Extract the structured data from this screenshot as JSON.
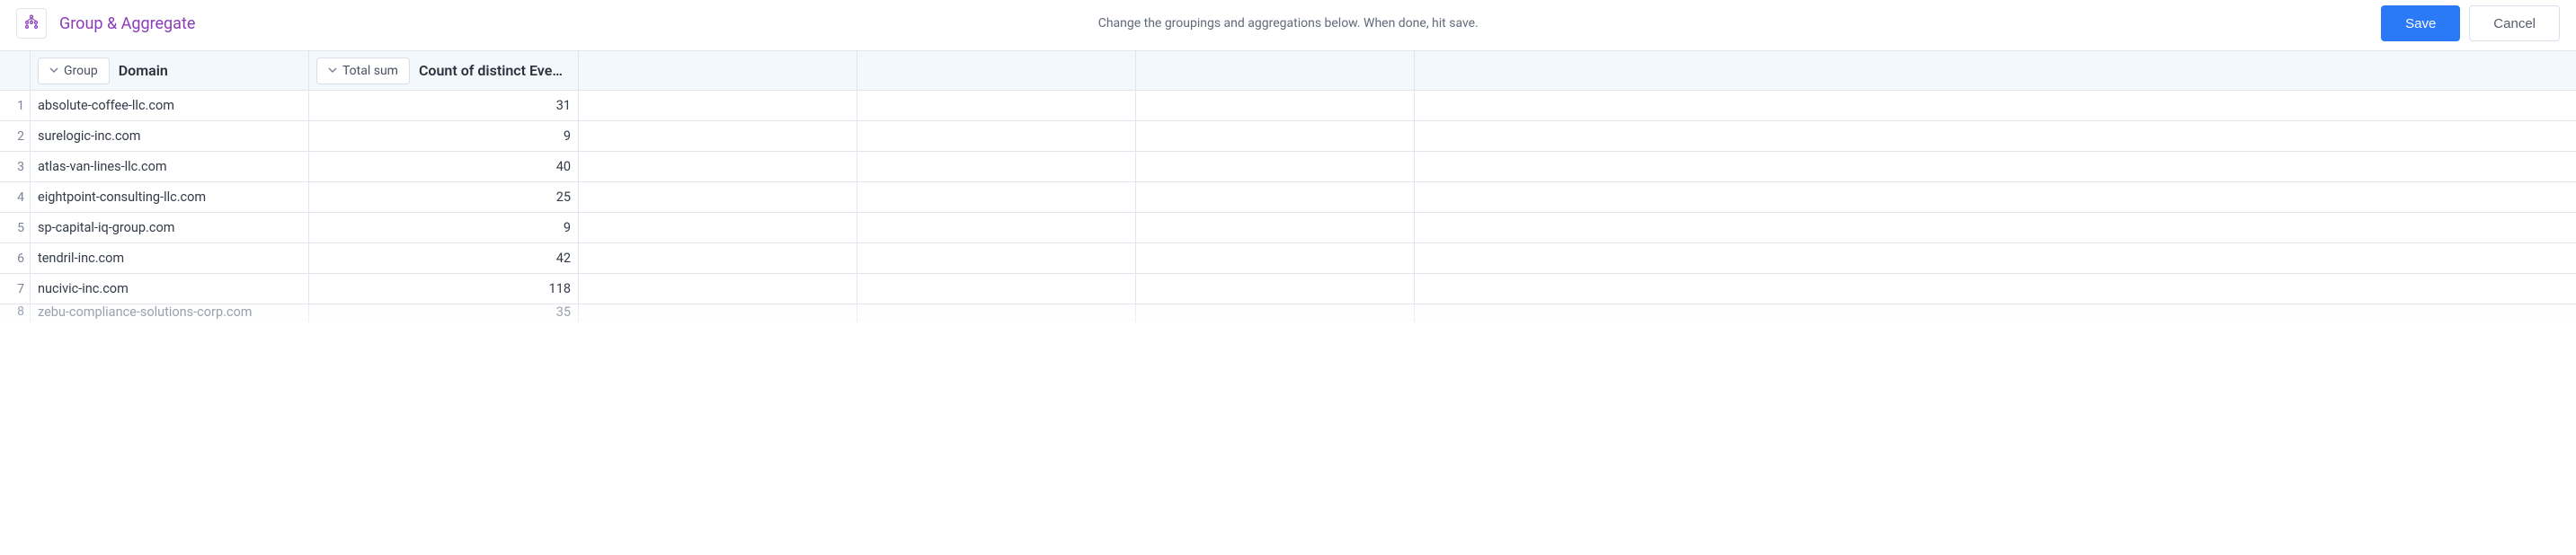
{
  "header": {
    "title": "Group & Aggregate",
    "helper": "Change the groupings and aggregations below. When done, hit save.",
    "save_label": "Save",
    "cancel_label": "Cancel"
  },
  "columns": {
    "group": {
      "pill": "Group",
      "title": "Domain"
    },
    "agg": {
      "pill": "Total sum",
      "title": "Count of distinct Eve…"
    }
  },
  "rows": [
    {
      "n": "1",
      "domain": "absolute-coffee-llc.com",
      "count": "31"
    },
    {
      "n": "2",
      "domain": "surelogic-inc.com",
      "count": "9"
    },
    {
      "n": "3",
      "domain": "atlas-van-lines-llc.com",
      "count": "40"
    },
    {
      "n": "4",
      "domain": "eightpoint-consulting-llc.com",
      "count": "25"
    },
    {
      "n": "5",
      "domain": "sp-capital-iq-group.com",
      "count": "9"
    },
    {
      "n": "6",
      "domain": "tendril-inc.com",
      "count": "42"
    },
    {
      "n": "7",
      "domain": "nucivic-inc.com",
      "count": "118"
    }
  ],
  "partial_row": {
    "n": "8",
    "domain": "zebu-compliance-solutions-corp.com",
    "count": "35"
  }
}
